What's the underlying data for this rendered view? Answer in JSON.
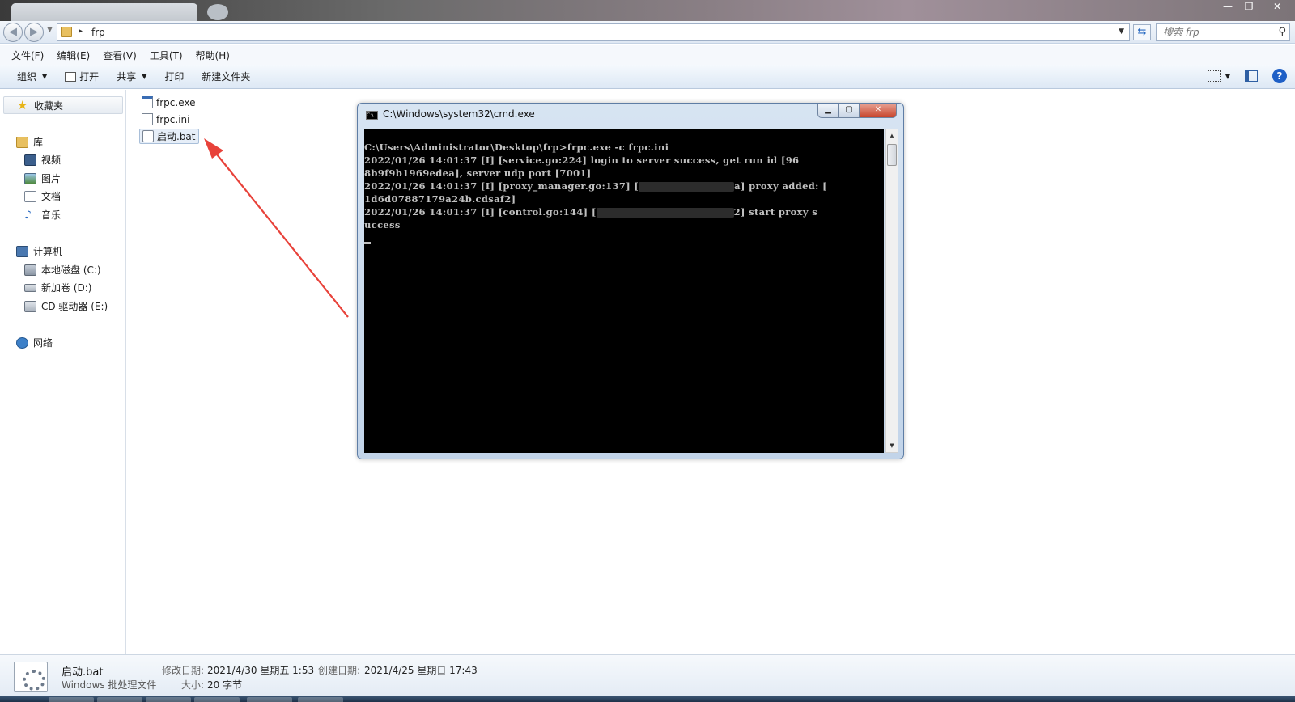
{
  "window": {
    "min_label": "—",
    "max_label": "❐",
    "close_label": "✕"
  },
  "address": {
    "path": "frp",
    "search_placeholder": "搜索 frp"
  },
  "menu": [
    "文件(F)",
    "编辑(E)",
    "查看(V)",
    "工具(T)",
    "帮助(H)"
  ],
  "commands": {
    "organize": "组织",
    "open": "打开",
    "share": "共享",
    "print": "打印",
    "new_folder": "新建文件夹"
  },
  "nav": {
    "favorites": "收藏夹",
    "library": "库",
    "videos": "视频",
    "pictures": "图片",
    "documents": "文档",
    "music": "音乐",
    "computer": "计算机",
    "drive_c": "本地磁盘 (C:)",
    "drive_d": "新加卷 (D:)",
    "drive_e": "CD 驱动器 (E:)",
    "network": "网络"
  },
  "files": [
    {
      "name": "frpc.exe",
      "icon": "exe-icon"
    },
    {
      "name": "frpc.ini",
      "icon": "ini-icon"
    },
    {
      "name": "启动.bat",
      "icon": "bat-icon",
      "selected": true
    }
  ],
  "cmd_window": {
    "title": "C:\\Windows\\system32\\cmd.exe",
    "lines": [
      "C:\\Users\\Administrator\\Desktop\\frp>frpc.exe -c frpc.ini",
      "2022/01/26 14:01:37 [I] [service.go:224] login to server success, get run id [96",
      "8b9f9b1969edea], server udp port [7001]",
      "2022/01/26 14:01:37 [I] [proxy_manager.go:137] [",
      "a] proxy added: [",
      "1d6d07887179a24b.cdsaf2]",
      "2022/01/26 14:01:37 [I] [control.go:144] [",
      "2] start proxy s",
      "uccess"
    ]
  },
  "details": {
    "name": "启动.bat",
    "type": "Windows 批处理文件",
    "modified_label": "修改日期:",
    "modified_value": "2021/4/30 星期五 1:53",
    "created_label": "创建日期:",
    "created_value": "2021/4/25 星期日 17:43",
    "size_label": "大小:",
    "size_value": "20 字节"
  },
  "colors": {
    "annotation_arrow": "#e8423a",
    "console_bg": "#000000",
    "console_text": "#c0c0c0"
  }
}
